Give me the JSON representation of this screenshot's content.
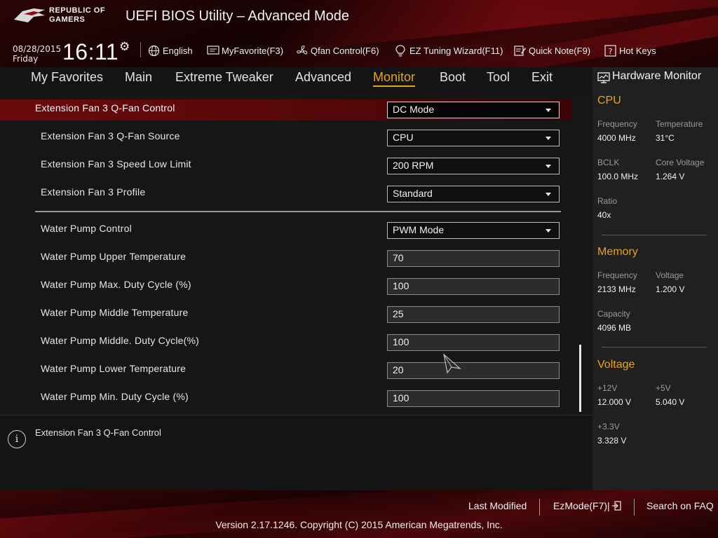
{
  "header": {
    "brand_line1": "REPUBLIC OF",
    "brand_line2": "GAMERS",
    "title": "UEFI BIOS Utility – Advanced Mode",
    "date": "08/28/2015",
    "weekday": "Friday",
    "time": "16:11",
    "toolbar": [
      {
        "label": "English",
        "icon": "globe-icon"
      },
      {
        "label": "MyFavorite(F3)",
        "icon": "favorite-screen-icon"
      },
      {
        "label": "Qfan Control(F6)",
        "icon": "fan-icon"
      },
      {
        "label": "EZ Tuning Wizard(F11)",
        "icon": "lightbulb-icon"
      },
      {
        "label": "Quick Note(F9)",
        "icon": "note-pen-icon"
      },
      {
        "label": "Hot Keys",
        "icon": "question-icon"
      }
    ]
  },
  "tabs": [
    {
      "label": "My Favorites"
    },
    {
      "label": "Main"
    },
    {
      "label": "Extreme Tweaker"
    },
    {
      "label": "Advanced"
    },
    {
      "label": "Monitor",
      "active": true
    },
    {
      "label": "Boot"
    },
    {
      "label": "Tool"
    },
    {
      "label": "Exit"
    }
  ],
  "settings": [
    {
      "label": "Extension Fan 3 Q-Fan Control",
      "value": "DC Mode",
      "type": "dropdown",
      "selected": true
    },
    {
      "label": "Extension Fan 3 Q-Fan Source",
      "value": "CPU",
      "type": "dropdown"
    },
    {
      "label": "Extension Fan 3 Speed Low Limit",
      "value": "200 RPM",
      "type": "dropdown"
    },
    {
      "label": "Extension Fan 3 Profile",
      "value": "Standard",
      "type": "dropdown"
    },
    {
      "label": "Water Pump Control",
      "value": "PWM Mode",
      "type": "dropdown"
    },
    {
      "label": "Water Pump Upper Temperature",
      "value": "70",
      "type": "number"
    },
    {
      "label": "Water Pump Max. Duty Cycle (%)",
      "value": "100",
      "type": "number"
    },
    {
      "label": "Water Pump Middle Temperature",
      "value": "25",
      "type": "number"
    },
    {
      "label": "Water Pump Middle. Duty Cycle(%)",
      "value": "100",
      "type": "number"
    },
    {
      "label": "Water Pump Lower Temperature",
      "value": "20",
      "type": "number"
    },
    {
      "label": "Water Pump Min. Duty Cycle (%)",
      "value": "100",
      "type": "number"
    }
  ],
  "help": {
    "text": "Extension Fan 3 Q-Fan Control"
  },
  "hardware_monitor": {
    "title": "Hardware Monitor",
    "cpu": {
      "heading": "CPU",
      "frequency_label": "Frequency",
      "frequency": "4000 MHz",
      "temperature_label": "Temperature",
      "temperature": "31°C",
      "bclk_label": "BCLK",
      "bclk": "100.0 MHz",
      "core_voltage_label": "Core Voltage",
      "core_voltage": "1.264 V",
      "ratio_label": "Ratio",
      "ratio": "40x"
    },
    "memory": {
      "heading": "Memory",
      "frequency_label": "Frequency",
      "frequency": "2133 MHz",
      "voltage_label": "Voltage",
      "voltage": "1.200 V",
      "capacity_label": "Capacity",
      "capacity": "4096 MB"
    },
    "voltage": {
      "heading": "Voltage",
      "v12_label": "+12V",
      "v12": "12.000 V",
      "v5_label": "+5V",
      "v5": "5.040 V",
      "v33_label": "+3.3V",
      "v33": "3.328 V"
    }
  },
  "footer": {
    "last_modified": "Last Modified",
    "ezmode": "EzMode(F7)|",
    "search_faq": "Search on FAQ",
    "copyright": "Version 2.17.1246. Copyright (C) 2015 American Megatrends, Inc."
  },
  "colors": {
    "accent": "#e8a21c",
    "selected_row": "#6b0a0c",
    "brand_red": "#8c0a10"
  }
}
